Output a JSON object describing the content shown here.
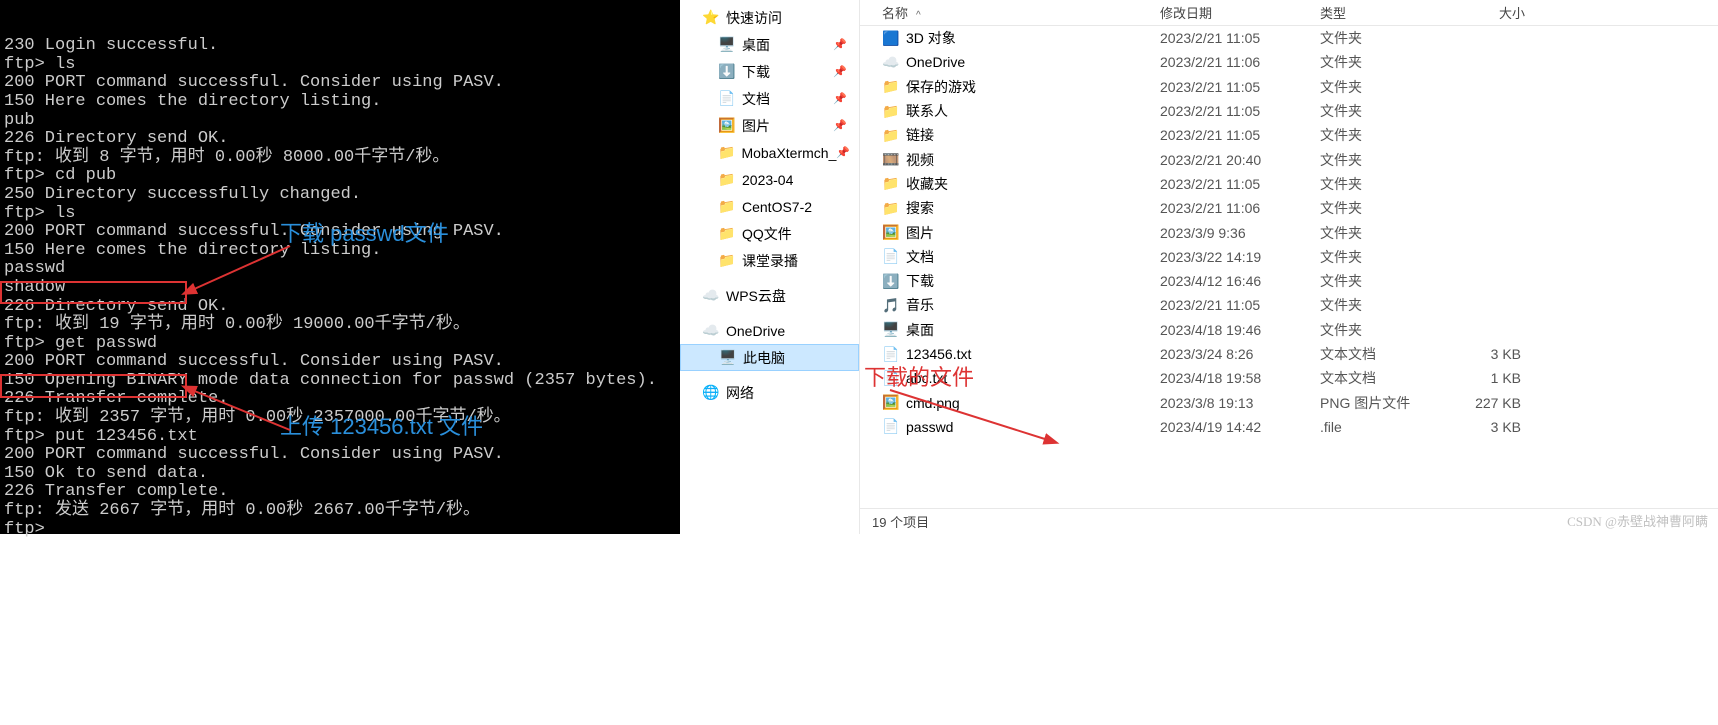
{
  "terminal": {
    "lines": [
      "230 Login successful.",
      "ftp> ls",
      "200 PORT command successful. Consider using PASV.",
      "150 Here comes the directory listing.",
      "pub",
      "226 Directory send OK.",
      "ftp: 收到 8 字节，用时 0.00秒 8000.00千字节/秒。",
      "ftp> cd pub",
      "250 Directory successfully changed.",
      "ftp> ls",
      "200 PORT command successful. Consider using PASV.",
      "150 Here comes the directory listing.",
      "passwd",
      "shadow",
      "226 Directory send OK.",
      "ftp: 收到 19 字节，用时 0.00秒 19000.00千字节/秒。",
      "ftp> get passwd",
      "200 PORT command successful. Consider using PASV.",
      "150 Opening BINARY mode data connection for passwd (2357 bytes).",
      "226 Transfer complete.",
      "ftp: 收到 2357 字节，用时 0.00秒 2357000.00千字节/秒。",
      "ftp> put 123456.txt",
      "200 PORT command successful. Consider using PASV.",
      "150 Ok to send data.",
      "226 Transfer complete.",
      "ftp: 发送 2667 字节，用时 0.00秒 2667.00千字节/秒。",
      "ftp>"
    ]
  },
  "annotations": {
    "download_passwd": "下载 passwd文件",
    "upload_123456": "上传 123456.txt 文件",
    "downloaded_file": "下载的文件"
  },
  "nav": {
    "quick_access": "快速访问",
    "items_pinned": [
      {
        "icon": "🖥️",
        "label": "桌面"
      },
      {
        "icon": "⬇️",
        "label": "下载"
      },
      {
        "icon": "📄",
        "label": "文档"
      },
      {
        "icon": "🖼️",
        "label": "图片"
      },
      {
        "icon": "📁",
        "label": "MobaXtermch_"
      }
    ],
    "items_plain": [
      {
        "icon": "📁",
        "label": "2023-04"
      },
      {
        "icon": "📁",
        "label": "CentOS7-2"
      },
      {
        "icon": "📁",
        "label": "QQ文件"
      },
      {
        "icon": "📁",
        "label": "课堂录播"
      }
    ],
    "wps": "WPS云盘",
    "onedrive": "OneDrive",
    "thispc": "此电脑",
    "network": "网络"
  },
  "columns": {
    "name": "名称",
    "date": "修改日期",
    "type": "类型",
    "size": "大小"
  },
  "files": [
    {
      "icon": "3d",
      "name": "3D 对象",
      "date": "2023/2/21 11:05",
      "type": "文件夹",
      "size": ""
    },
    {
      "icon": "od",
      "name": "OneDrive",
      "date": "2023/2/21 11:06",
      "type": "文件夹",
      "size": ""
    },
    {
      "icon": "fd",
      "name": "保存的游戏",
      "date": "2023/2/21 11:05",
      "type": "文件夹",
      "size": ""
    },
    {
      "icon": "fd",
      "name": "联系人",
      "date": "2023/2/21 11:05",
      "type": "文件夹",
      "size": ""
    },
    {
      "icon": "fd",
      "name": "链接",
      "date": "2023/2/21 11:05",
      "type": "文件夹",
      "size": ""
    },
    {
      "icon": "vd",
      "name": "视频",
      "date": "2023/2/21 20:40",
      "type": "文件夹",
      "size": ""
    },
    {
      "icon": "fd",
      "name": "收藏夹",
      "date": "2023/2/21 11:05",
      "type": "文件夹",
      "size": ""
    },
    {
      "icon": "fd",
      "name": "搜索",
      "date": "2023/2/21 11:06",
      "type": "文件夹",
      "size": ""
    },
    {
      "icon": "pic",
      "name": "图片",
      "date": "2023/3/9 9:36",
      "type": "文件夹",
      "size": ""
    },
    {
      "icon": "doc",
      "name": "文档",
      "date": "2023/3/22 14:19",
      "type": "文件夹",
      "size": ""
    },
    {
      "icon": "dl",
      "name": "下载",
      "date": "2023/4/12 16:46",
      "type": "文件夹",
      "size": ""
    },
    {
      "icon": "mus",
      "name": "音乐",
      "date": "2023/2/21 11:05",
      "type": "文件夹",
      "size": ""
    },
    {
      "icon": "desk",
      "name": "桌面",
      "date": "2023/4/18 19:46",
      "type": "文件夹",
      "size": ""
    },
    {
      "icon": "txt",
      "name": "123456.txt",
      "date": "2023/3/24 8:26",
      "type": "文本文档",
      "size": "3 KB"
    },
    {
      "icon": "txt",
      "name": "abc.txt",
      "date": "2023/4/18 19:58",
      "type": "文本文档",
      "size": "1 KB"
    },
    {
      "icon": "png",
      "name": "cmd.png",
      "date": "2023/3/8 19:13",
      "type": "PNG 图片文件",
      "size": "227 KB"
    },
    {
      "icon": "file",
      "name": "passwd",
      "date": "2023/4/19 14:42",
      "type": ".file",
      "size": "3 KB"
    }
  ],
  "status": "19 个项目",
  "watermark": "CSDN @赤壁战神曹阿瞒"
}
